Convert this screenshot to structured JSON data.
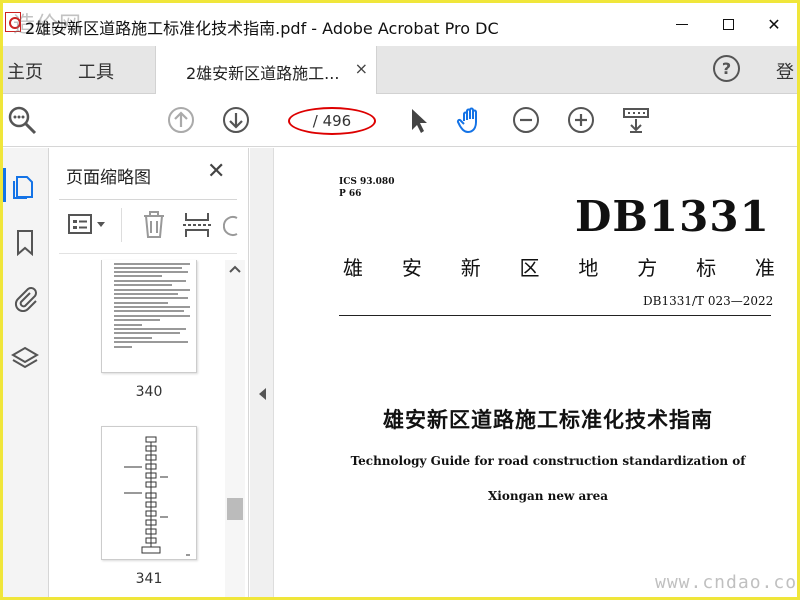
{
  "window": {
    "title": "2雄安新区道路施工标准化技术指南.pdf - Adobe Acrobat Pro DC",
    "watermark": "造价网",
    "minimize_icon": "minimize-icon",
    "maximize_icon": "maximize-icon",
    "close_label": "✕"
  },
  "nav": {
    "home": "主页",
    "tools": "工具",
    "login": "登"
  },
  "tab": {
    "label": "2雄安新区道路施工...",
    "close": "×"
  },
  "toolbar": {
    "page_display": "/ 496",
    "icons": [
      "magnifier-icon",
      "prev-page-icon",
      "next-page-icon",
      "select-cursor-icon",
      "hand-tool-icon",
      "zoom-out-icon",
      "zoom-in-icon",
      "reading-mode-icon"
    ]
  },
  "rail": {
    "icons": [
      "pages-icon",
      "bookmark-icon",
      "attachment-icon",
      "layers-icon"
    ]
  },
  "panel": {
    "title": "页面缩略图",
    "close": "✕",
    "thumbnails": [
      {
        "label": "340"
      },
      {
        "label": "341"
      }
    ]
  },
  "document": {
    "ics": "ICS 93.080",
    "p_code": "P 66",
    "code": "DB1331",
    "std_chars": [
      "雄",
      "安",
      "新",
      "区",
      "地",
      "方",
      "标",
      "准"
    ],
    "std_number": "DB1331/T 023—2022",
    "title_cn": "雄安新区道路施工标准化技术指南",
    "title_en_line1": "Technology Guide for road construction standardization of",
    "title_en_line2": "Xiongan new area",
    "watermark": "www.cndao.com"
  },
  "colors": {
    "frame": "#f0e63a",
    "annotation_ellipse": "#dd0000",
    "active_rail": "#1473e6",
    "hand_tool": "#1473e6"
  }
}
